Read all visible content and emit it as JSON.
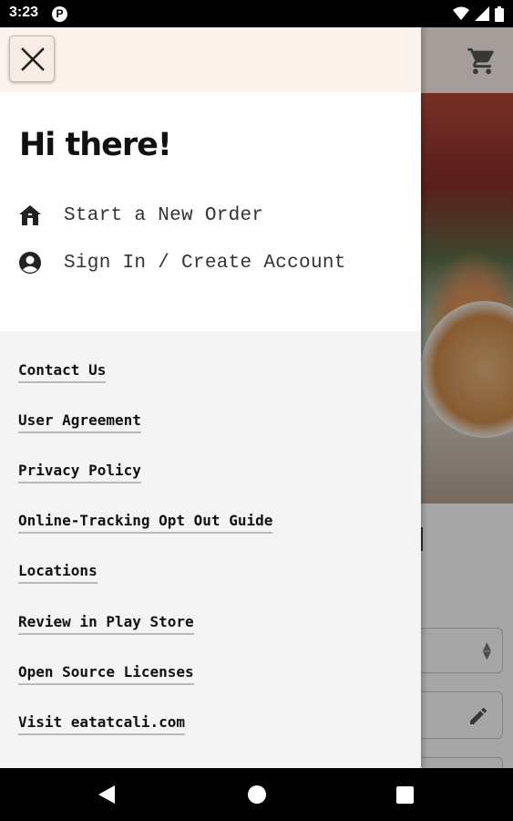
{
  "status_bar": {
    "time": "3:23",
    "app_badge": "P",
    "icons": [
      "wifi-icon",
      "signal-icon",
      "battery-icon"
    ]
  },
  "drawer": {
    "greeting": "Hi there!",
    "close_icon": "close-icon",
    "nav_items": [
      {
        "icon": "home-icon",
        "label": "Start a New Order"
      },
      {
        "icon": "account-circle-icon",
        "label": "Sign In / Create Account"
      }
    ],
    "links": [
      {
        "label": "Contact Us"
      },
      {
        "label": "User Agreement"
      },
      {
        "label": "Privacy Policy"
      },
      {
        "label": "Online-Tracking Opt Out Guide"
      },
      {
        "label": "Locations"
      },
      {
        "label": "Review in Play Store"
      },
      {
        "label": "Open Source Licenses"
      },
      {
        "label": "Visit eatatcali.com"
      }
    ]
  },
  "background": {
    "cart_icon": "cart-icon",
    "pencil_icon": "pencil-icon"
  },
  "colors": {
    "header_bg": "#fcf2ec",
    "drawer_bg": "#f4f4f4",
    "link_underline": "#b9b9b9",
    "text": "#111111"
  },
  "system_nav": [
    "back-icon",
    "home-circle-icon",
    "recents-square-icon"
  ]
}
